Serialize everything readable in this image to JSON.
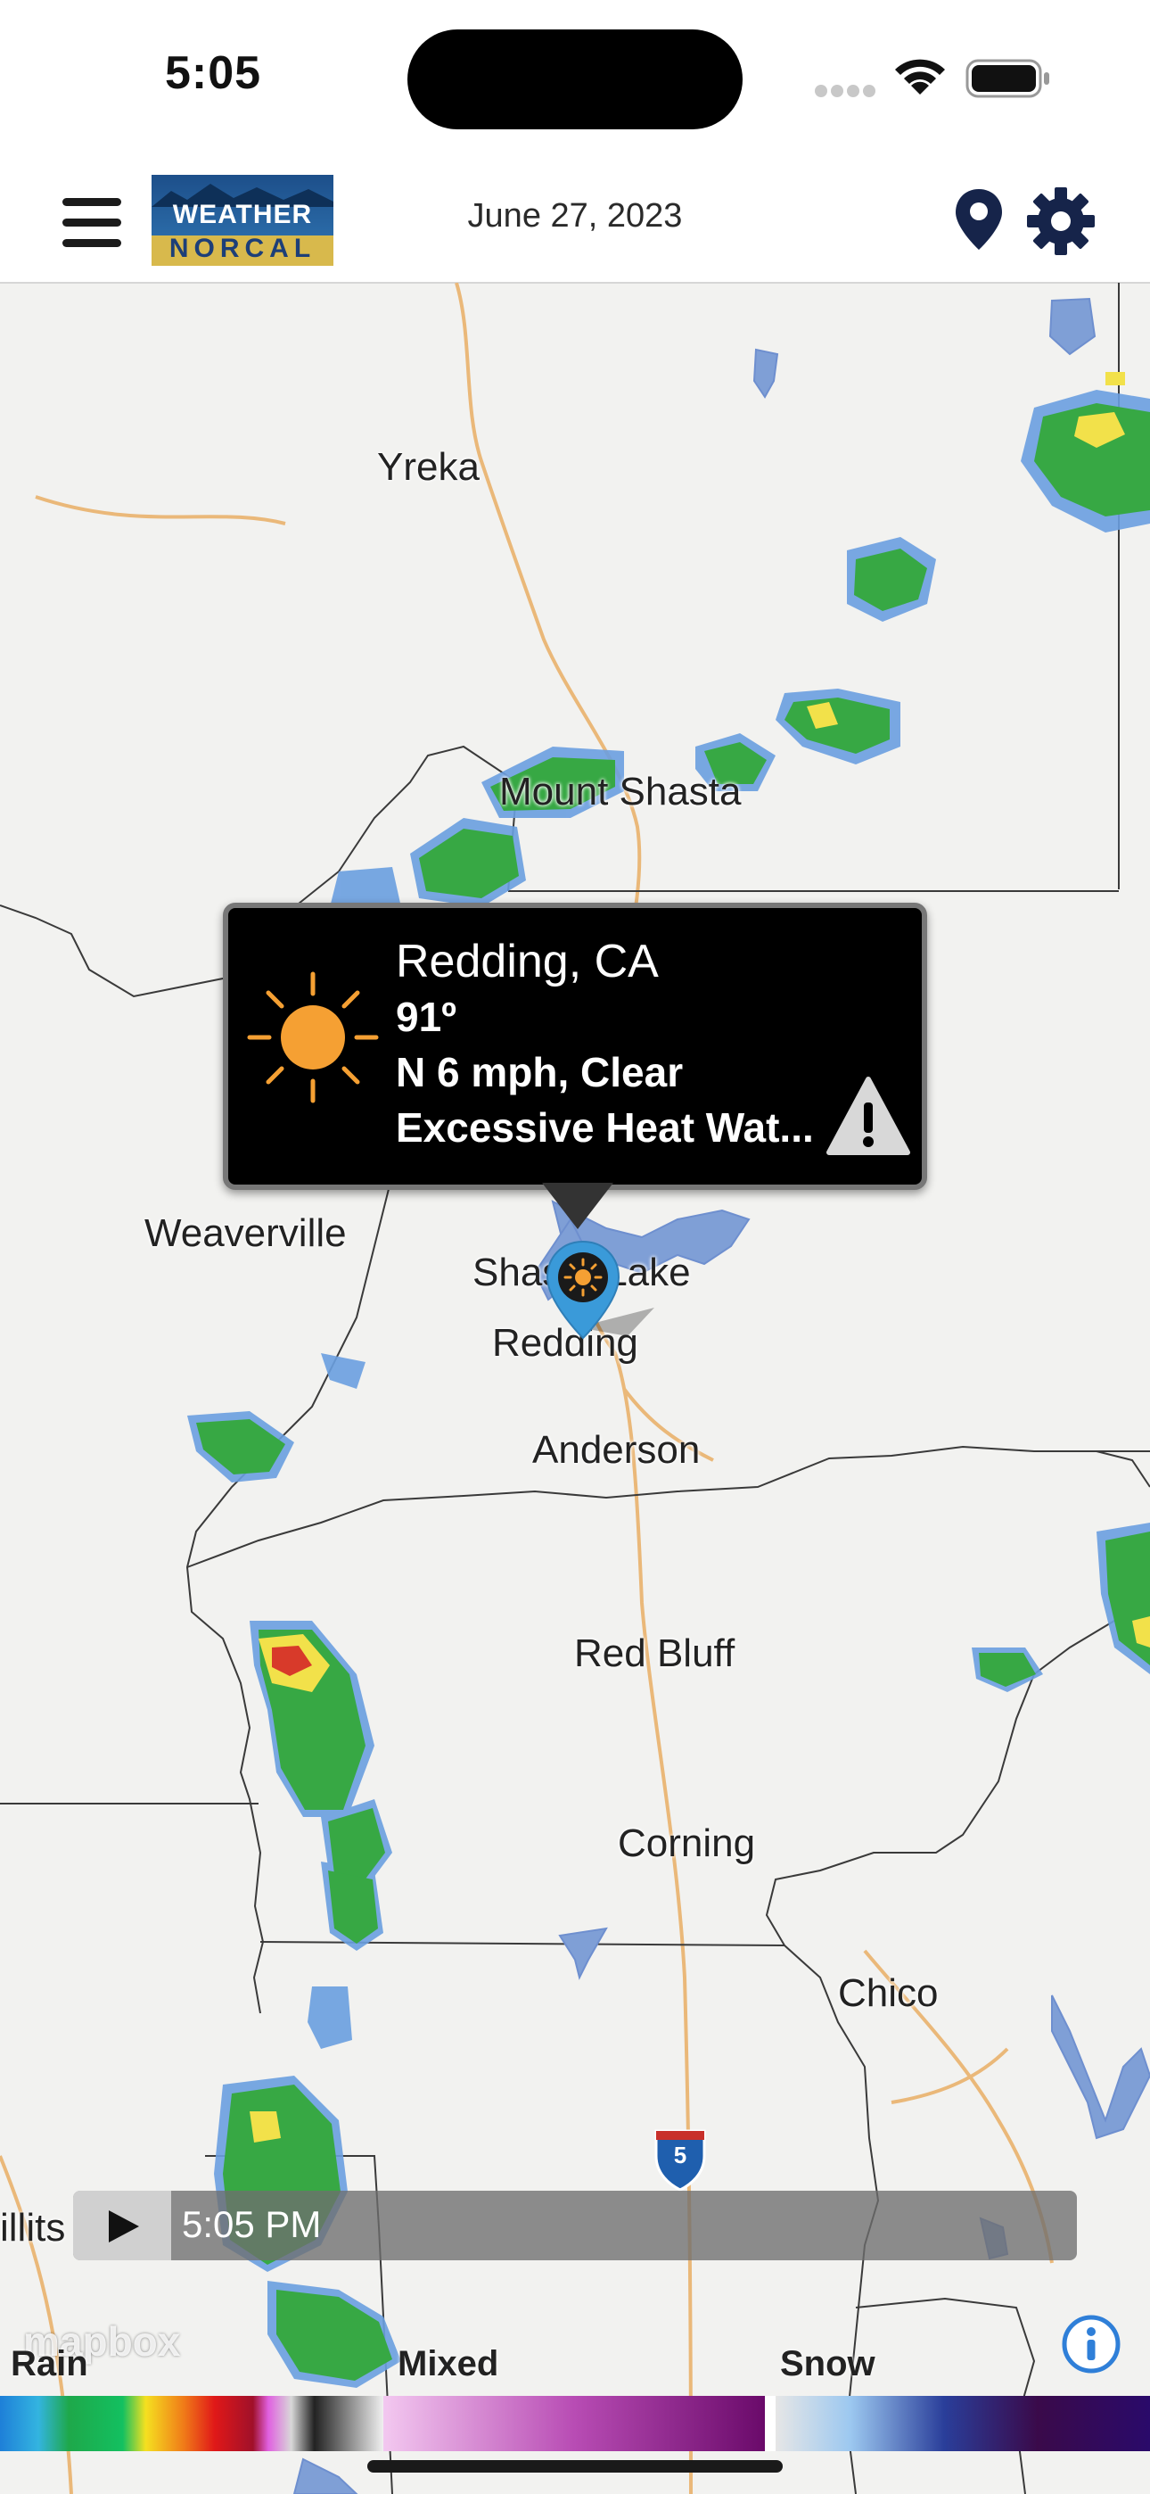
{
  "status_bar": {
    "time": "5:05",
    "icons": [
      "signal-icon",
      "wifi-icon",
      "battery-icon"
    ]
  },
  "header": {
    "logo_line1": "WEATHER",
    "logo_line2": "NORCAL",
    "date": "June 27, 2023",
    "icons": [
      "menu-icon",
      "location-pin-icon",
      "gear-icon"
    ]
  },
  "map": {
    "cities": {
      "yreka": "Yreka",
      "mount_shasta": "Mount Shasta",
      "weaverville": "Weaverville",
      "shasta_lake": "Shasta Lake",
      "redding": "Redding",
      "anderson": "Anderson",
      "red_bluff": "Red Bluff",
      "corning": "Corning",
      "chico": "Chico",
      "willits": "illits"
    },
    "highway_shield": "5"
  },
  "popup": {
    "location": "Redding, CA",
    "temperature": "91º",
    "wind_condition": "N 6 mph,  Clear",
    "alert": "Excessive Heat Wat...",
    "icons": [
      "sun-icon",
      "warning-icon"
    ]
  },
  "timeline": {
    "time": "5:05 PM",
    "icon": "play-icon"
  },
  "attribution": "mapbox",
  "legend": {
    "rain": "Rain",
    "mixed": "Mixed",
    "snow": "Snow"
  },
  "colors": {
    "map_background": "#f2f2f0",
    "popup_background": "#000000",
    "header_navy": "#16244a",
    "marker_blue": "#3a9ad9",
    "sun_orange": "#f5a033"
  }
}
